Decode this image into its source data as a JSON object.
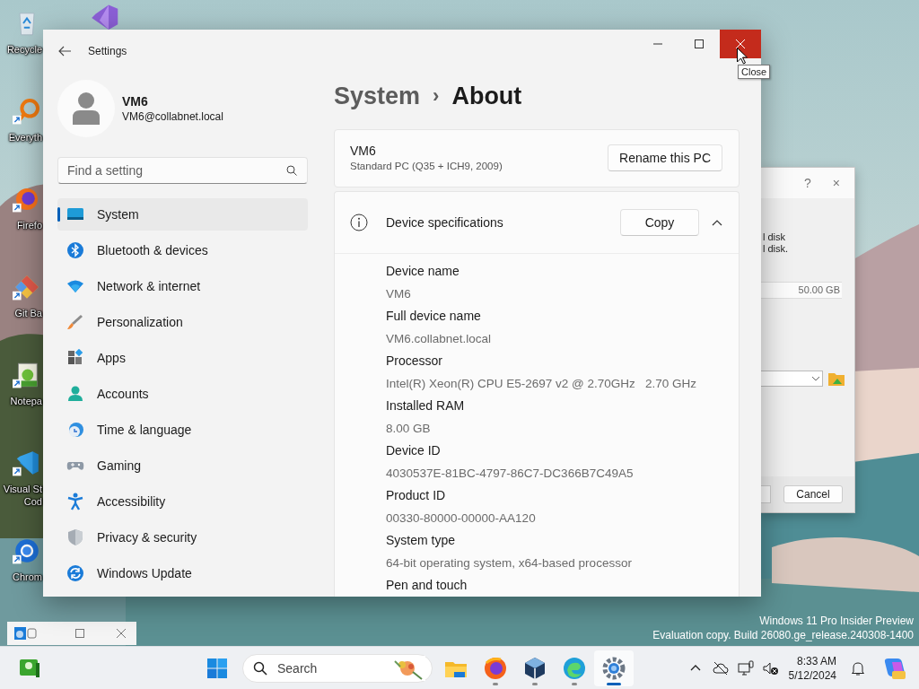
{
  "desktop": {
    "icons": [
      {
        "lines": [
          "Recycle"
        ]
      },
      {
        "lines": [
          "Everyth"
        ]
      },
      {
        "lines": [
          "Firefo"
        ]
      },
      {
        "lines": [
          "Git Ba"
        ]
      },
      {
        "lines": [
          "Notepa"
        ]
      },
      {
        "lines": [
          "Visual St",
          "Cod"
        ]
      },
      {
        "lines": [
          "Chrom"
        ]
      }
    ],
    "watermark": [
      "Windows 11 Pro Insider Preview",
      "Evaluation copy. Build 26080.ge_release.240308-1400"
    ]
  },
  "background_dialog": {
    "help": "?",
    "close": "×",
    "lines": [
      "l disk",
      "l disk."
    ],
    "size": "50.00 GB",
    "cancel": "Cancel"
  },
  "settings": {
    "title": "Settings",
    "close_hovered": true,
    "tooltip": "Close",
    "profile": {
      "name": "VM6",
      "email": "VM6@collabnet.local"
    },
    "search": {
      "placeholder": "Find a setting"
    },
    "nav": [
      {
        "label": "System",
        "selected": true
      },
      {
        "label": "Bluetooth & devices",
        "selected": false
      },
      {
        "label": "Network & internet",
        "selected": false
      },
      {
        "label": "Personalization",
        "selected": false
      },
      {
        "label": "Apps",
        "selected": false
      },
      {
        "label": "Accounts",
        "selected": false
      },
      {
        "label": "Time & language",
        "selected": false
      },
      {
        "label": "Gaming",
        "selected": false
      },
      {
        "label": "Accessibility",
        "selected": false
      },
      {
        "label": "Privacy & security",
        "selected": false
      },
      {
        "label": "Windows Update",
        "selected": false
      }
    ],
    "breadcrumb": {
      "parent": "System",
      "separator": "›",
      "current": "About"
    },
    "pc_card": {
      "name": "VM6",
      "model": "Standard PC (Q35 + ICH9, 2009)",
      "button": "Rename this PC"
    },
    "specs": {
      "title": "Device specifications",
      "button": "Copy",
      "expanded": true,
      "items": [
        {
          "label": "Device name",
          "value": "VM6"
        },
        {
          "label": "Full device name",
          "value": "VM6.collabnet.local"
        },
        {
          "label": "Processor",
          "value": "Intel(R) Xeon(R) CPU E5-2697 v2 @ 2.70GHz   2.70 GHz"
        },
        {
          "label": "Installed RAM",
          "value": "8.00 GB"
        },
        {
          "label": "Device ID",
          "value": "4030537E-81BC-4797-86C7-DC366B7C49A5"
        },
        {
          "label": "Product ID",
          "value": "00330-80000-00000-AA120"
        },
        {
          "label": "System type",
          "value": "64-bit operating system, x64-based processor"
        },
        {
          "label": "Pen and touch"
        }
      ]
    }
  },
  "taskbar": {
    "search_placeholder": "Search",
    "apps": [
      {
        "running": false,
        "selected": false
      },
      {
        "running": true,
        "selected": false
      },
      {
        "running": true,
        "selected": false
      },
      {
        "running": true,
        "selected": false
      },
      {
        "running": true,
        "selected": true
      }
    ],
    "time": "8:33 AM",
    "date": "5/12/2024"
  }
}
